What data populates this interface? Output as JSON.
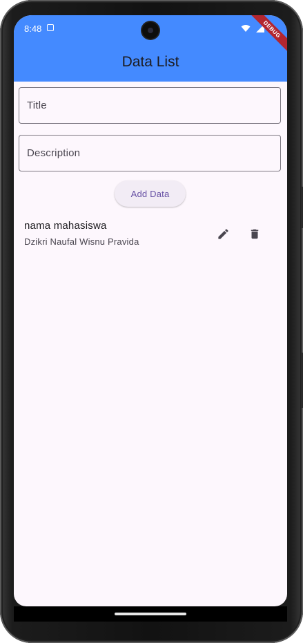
{
  "status_bar": {
    "time": "8:48"
  },
  "debug_banner": "DEBUG",
  "app_bar": {
    "title": "Data List",
    "color": "#448aff"
  },
  "form": {
    "title_placeholder": "Title",
    "description_placeholder": "Description",
    "title_value": "",
    "description_value": "",
    "add_button_label": "Add Data"
  },
  "items": [
    {
      "title": "nama mahasiswa",
      "subtitle": "Dzikri Naufal Wisnu Pravida",
      "actions": [
        "edit-icon",
        "delete-icon"
      ]
    }
  ],
  "colors": {
    "background": "#fdf7fd",
    "accent": "#6750a4",
    "icon": "#49454f"
  }
}
